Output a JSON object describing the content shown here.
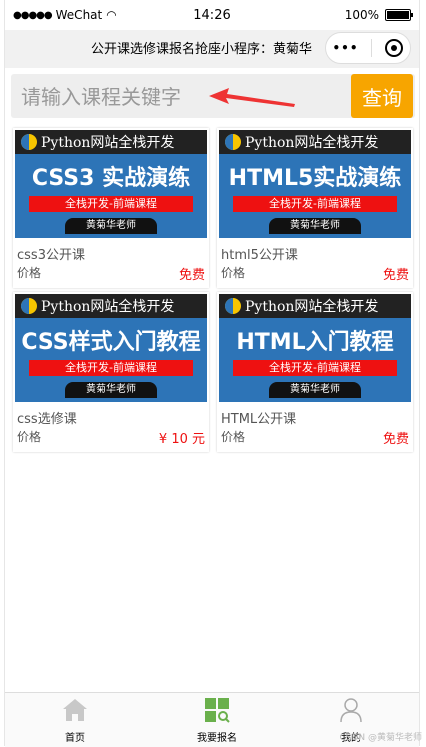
{
  "status": {
    "carrier": "WeChat",
    "time": "14:26",
    "battery": "100%"
  },
  "navbar": {
    "title": "公开课选修课报名抢座小程序：黄菊华",
    "more": "•••"
  },
  "search": {
    "placeholder": "请输入课程关键字",
    "button": "查询"
  },
  "courses": [
    {
      "banner_top": "Python网站全栈开发",
      "banner_title": "CSS3 实战演练",
      "banner_bar": "全栈开发-前端课程",
      "banner_teacher": "黄菊华老师",
      "name": "css3公开课",
      "price_label": "价格",
      "price": "免费"
    },
    {
      "banner_top": "Python网站全栈开发",
      "banner_title": "HTML5实战演练",
      "banner_bar": "全栈开发-前端课程",
      "banner_teacher": "黄菊华老师",
      "name": "html5公开课",
      "price_label": "价格",
      "price": "免费"
    },
    {
      "banner_top": "Python网站全栈开发",
      "banner_title": "CSS样式入门教程",
      "banner_bar": "全栈开发-前端课程",
      "banner_teacher": "黄菊华老师",
      "name": "css选修课",
      "price_label": "价格",
      "price": "¥ 10 元"
    },
    {
      "banner_top": "Python网站全栈开发",
      "banner_title": "HTML入门教程",
      "banner_bar": "全栈开发-前端课程",
      "banner_teacher": "黄菊华老师",
      "name": "HTML公开课",
      "price_label": "价格",
      "price": "免费"
    }
  ],
  "tabbar": {
    "home": "首页",
    "my_signup": "我要报名",
    "mine": "我的"
  },
  "watermark": "CSDN @黄菊华老师",
  "colors": {
    "accent": "#f7a500",
    "price": "#e11111",
    "active_tab": "#6ab04c"
  }
}
